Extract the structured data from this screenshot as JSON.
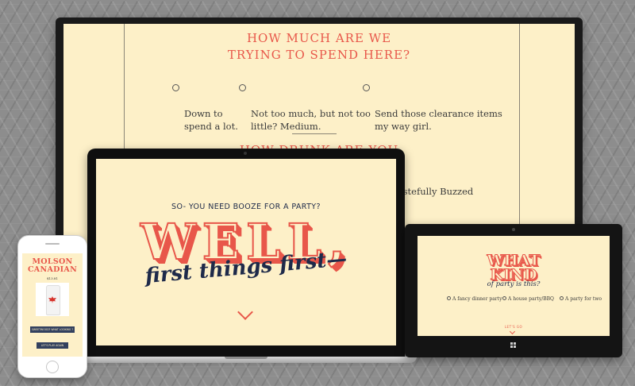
{
  "colors": {
    "accent": "#e8574a",
    "navy": "#1e2a4a",
    "cream": "#fdf0c8"
  },
  "desktop": {
    "question1": "HOW MUCH ARE WE\nTRYING TO SPEND HERE?",
    "options": [
      "Down to\nspend a lot.",
      "Not too much, but not too\nlittle? Medium.",
      "Send those clearance items\nmy way girl."
    ],
    "question2": "HOW DRUNK ARE YOU",
    "partial_option": "Tastefully Buzzed"
  },
  "laptop": {
    "tagline": "SO- YOU NEED BOOZE FOR A PARTY?",
    "headline": "WELL,",
    "script_line": "first things first—"
  },
  "tablet": {
    "title": "WHAT\nKIND",
    "script": "of party is this?",
    "options": [
      "A fancy dinner party",
      "A house party/BBQ",
      "A party for two"
    ],
    "go_label": "LET'S GO"
  },
  "phone": {
    "brand": "MOLSON\nCANADIAN",
    "price": "$13.81",
    "button1": "SWEETWOOD? WHAT LOOKING ?",
    "button2": "LET'S PLAY AGAIN"
  },
  "icons": [
    "radio-icon",
    "chevron-down-icon",
    "windows-logo-icon",
    "maple-leaf-icon"
  ]
}
